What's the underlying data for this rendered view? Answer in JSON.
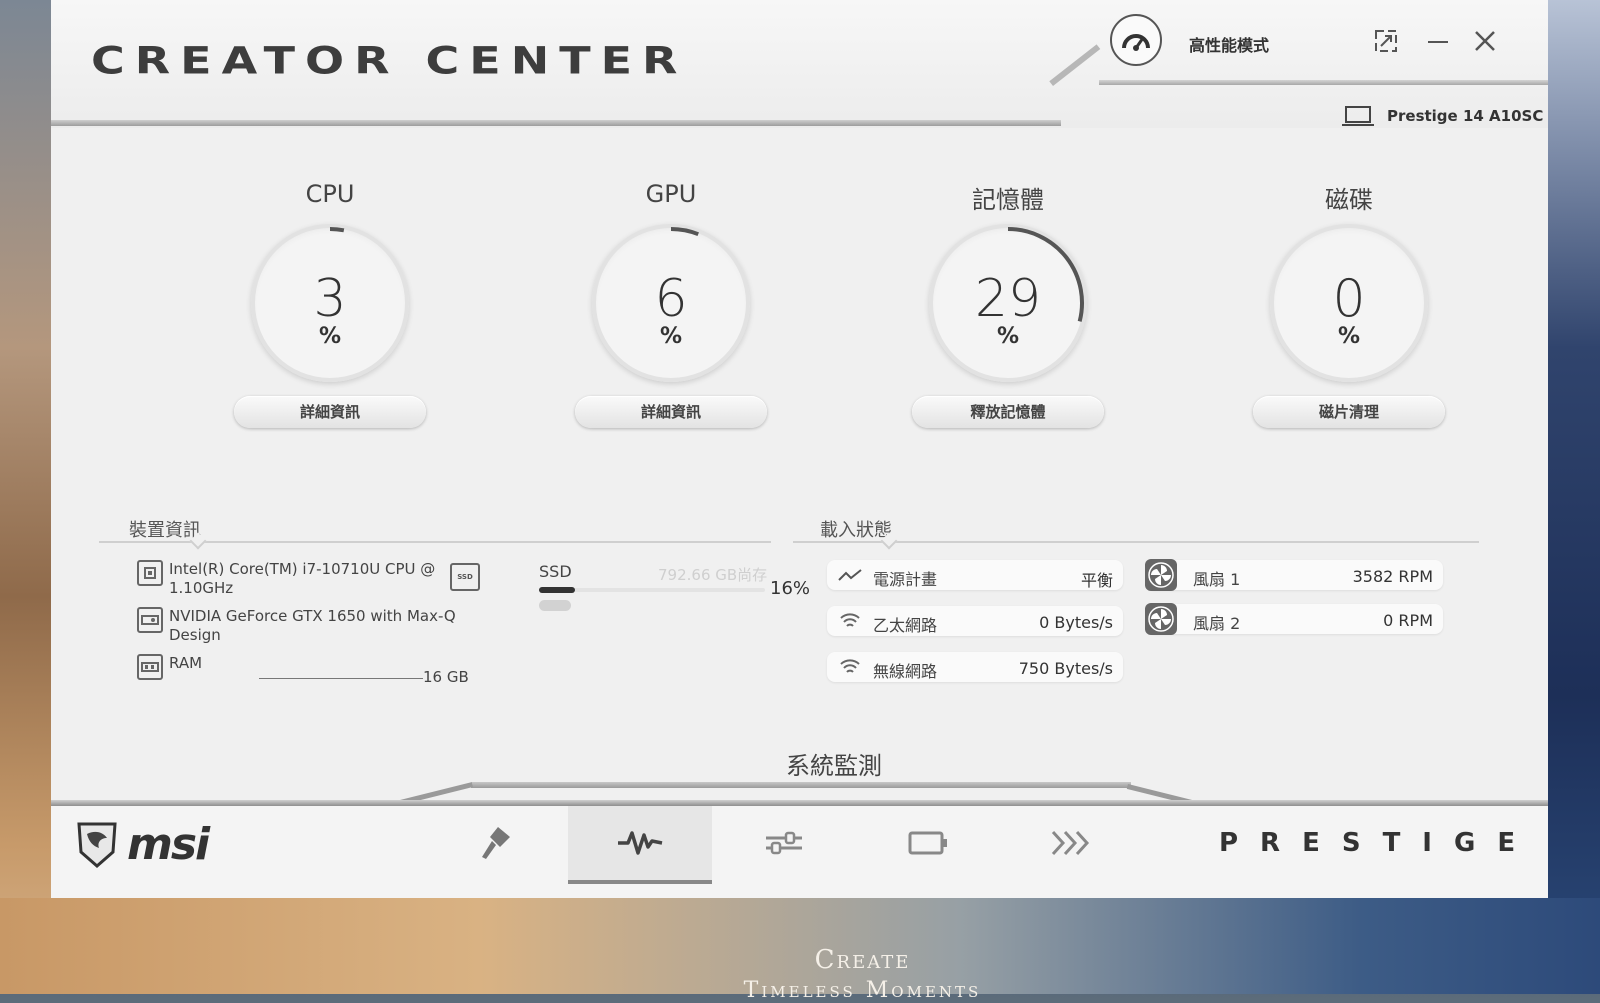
{
  "window": {
    "app_title": "CREATOR CENTER",
    "mode_label": "高性能模式",
    "device_model": "Prestige 14 A10SC"
  },
  "gauges": [
    {
      "title": "CPU",
      "value": "3",
      "unit": "%",
      "button": "詳細資訊",
      "percent": 3
    },
    {
      "title": "GPU",
      "value": "6",
      "unit": "%",
      "button": "詳細資訊",
      "percent": 6
    },
    {
      "title": "記憶體",
      "value": "29",
      "unit": "%",
      "button": "釋放記憶體",
      "percent": 29
    },
    {
      "title": "磁碟",
      "value": "0",
      "unit": "%",
      "button": "磁片清理",
      "percent": 0
    }
  ],
  "device_info": {
    "section_title": "裝置資訊",
    "cpu": "Intel(R) Core(TM) i7-10710U CPU @ 1.10GHz",
    "gpu": "NVIDIA GeForce GTX 1650 with Max-Q Design",
    "ram_label": "RAM",
    "ram_value": "16 GB",
    "ssd": {
      "label": "SSD",
      "free": "792.66 GB尚存",
      "percent_text": "16%",
      "percent": 16,
      "icon_text": "SSD"
    }
  },
  "load_status": {
    "section_title": "載入狀態",
    "power_plan": {
      "label": "電源計畫",
      "value": "平衡"
    },
    "ethernet": {
      "label": "乙太網路",
      "value": "0 Bytes/s"
    },
    "wifi": {
      "label": "無線網路",
      "value": "750 Bytes/s"
    },
    "fan1": {
      "label": "風扇 1",
      "value": "3582 RPM"
    },
    "fan2": {
      "label": "風扇 2",
      "value": "0 RPM"
    }
  },
  "footer": {
    "active_section": "系統監測",
    "brand": "msi",
    "product_line": "PRESTIGE",
    "tabs": [
      "creator-tools",
      "system-monitor",
      "settings",
      "battery",
      "advanced"
    ]
  },
  "desktop": {
    "caption_line1": "Create",
    "caption_line2": "Timeless Moments"
  },
  "colors": {
    "window_bg": "#f0f0f0",
    "gauge_arc": "#555555",
    "accent_dark": "#333333"
  }
}
